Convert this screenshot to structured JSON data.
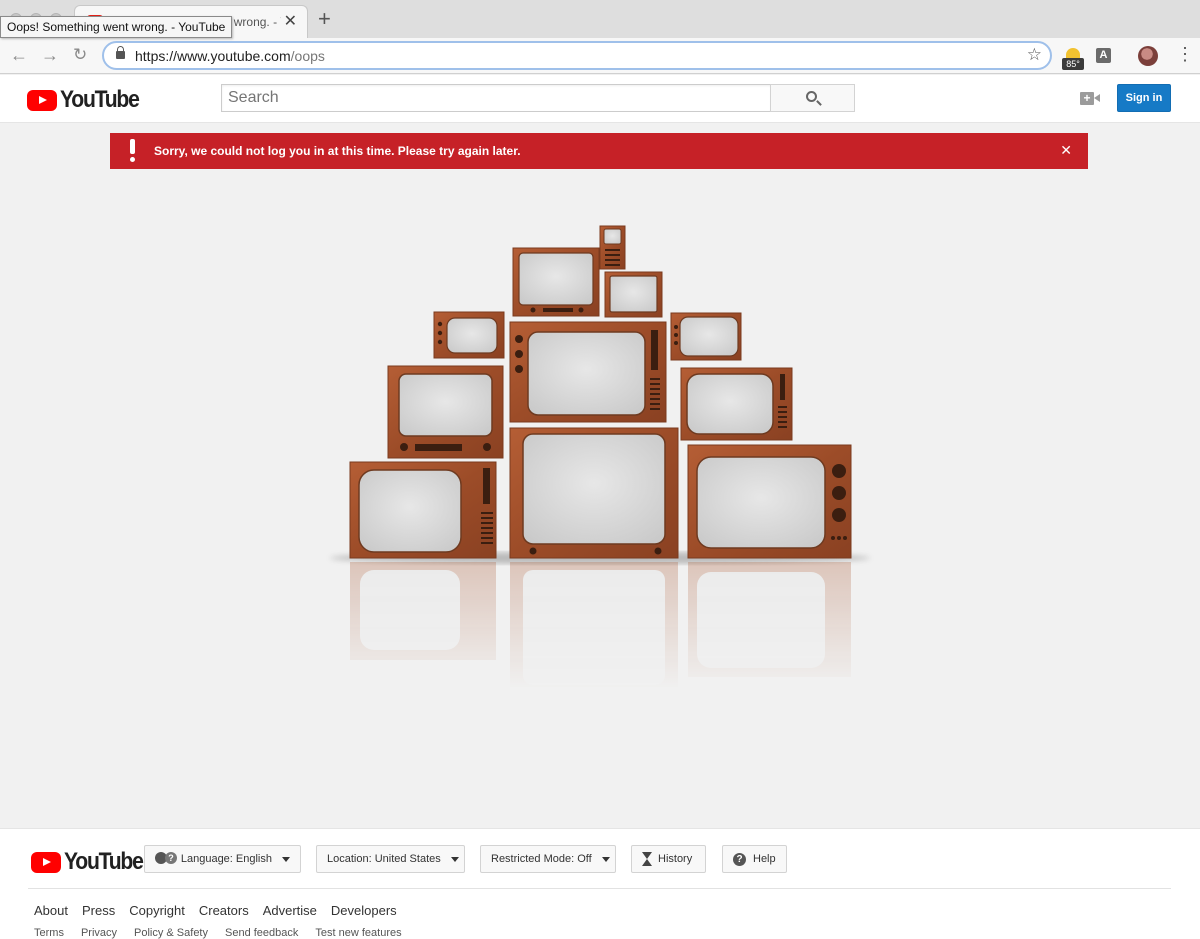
{
  "browser": {
    "tab_title": "Oops! Something went wrong. - YouTube",
    "tooltip": "Oops! Something went wrong. - YouTube",
    "url_host": "https://www.youtube.com",
    "url_path": "/oops",
    "weather_temp": "85°",
    "extension_letter": "A"
  },
  "header": {
    "logo_text": "YouTube",
    "search_placeholder": "Search",
    "signin_label": "Sign in"
  },
  "alert": {
    "message": "Sorry, we could not log you in at this time. Please try again later.",
    "color": "#c62127"
  },
  "illustration": {
    "wood_color": "#a3512b",
    "screen_color": "#d9d9d9"
  },
  "footer": {
    "logo_text": "YouTube",
    "language_label": "Language: English",
    "location_label": "Location: United States",
    "restricted_label": "Restricted Mode: Off",
    "history_label": "History",
    "help_label": "Help",
    "links": [
      "About",
      "Press",
      "Copyright",
      "Creators",
      "Advertise",
      "Developers"
    ],
    "sublinks": [
      "Terms",
      "Privacy",
      "Policy & Safety",
      "Send feedback",
      "Test new features"
    ]
  },
  "colors": {
    "brand_red": "#ff0000",
    "signin_blue": "#167ac6"
  }
}
